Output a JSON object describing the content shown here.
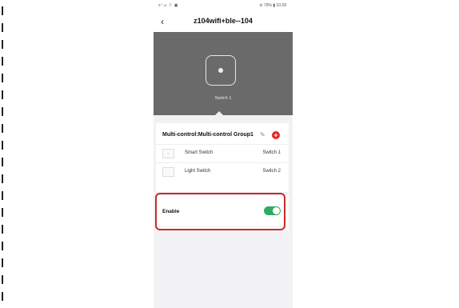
{
  "status_bar": {
    "left": "≡ᐟ⊿ ⌔ ▣",
    "right": "⊘ 79% ▮ 10:28"
  },
  "header": {
    "title": "z104wifi+ble--104"
  },
  "device": {
    "label": "Switch 1"
  },
  "group": {
    "title": "Multi-control:Multi-control Group1",
    "rows": [
      {
        "name": "Smart Switch",
        "value": "Switch 1",
        "thumb": "▫▫"
      },
      {
        "name": "Light Switch",
        "value": "Switch 2",
        "thumb": ""
      }
    ]
  },
  "enable": {
    "label": "Enable",
    "on": true
  },
  "colors": {
    "accent_green": "#2eab62",
    "add_red": "#e22626",
    "highlight_red": "#c72b2b"
  },
  "icons": {
    "back": "chevron-left-icon",
    "edit": "pencil-icon",
    "add": "plus-circle-icon"
  }
}
